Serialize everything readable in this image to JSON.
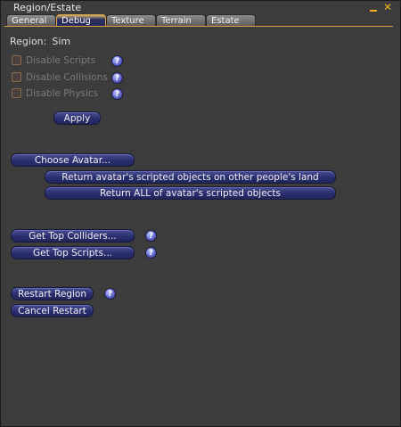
{
  "window": {
    "title": "Region/Estate"
  },
  "tabs": [
    {
      "label": "General"
    },
    {
      "label": "Debug"
    },
    {
      "label": "Texture"
    },
    {
      "label": "Terrain"
    },
    {
      "label": "Estate"
    }
  ],
  "active_tab": "Debug",
  "region": {
    "label": "Region:",
    "value": "Sim"
  },
  "checkboxes": [
    {
      "label": "Disable Scripts",
      "checked": false,
      "enabled": false
    },
    {
      "label": "Disable Collisions",
      "checked": false,
      "enabled": false
    },
    {
      "label": "Disable Physics",
      "checked": false,
      "enabled": false
    }
  ],
  "help_glyph": "?",
  "buttons": {
    "apply": "Apply",
    "choose_avatar": "Choose Avatar...",
    "return_other_land": "Return avatar's scripted objects on other people's land",
    "return_all": "Return ALL of avatar's scripted objects",
    "top_colliders": "Get Top Colliders...",
    "top_scripts": "Get Top Scripts...",
    "restart_region": "Restart Region",
    "cancel_restart": "Cancel Restart"
  },
  "icons": {
    "minimize": "minimize-icon",
    "close": "close-icon",
    "close_glyph": "✕"
  },
  "colors": {
    "accent": "#d8a340",
    "button": "#2a2e6e",
    "background": "#3c3c3c"
  }
}
